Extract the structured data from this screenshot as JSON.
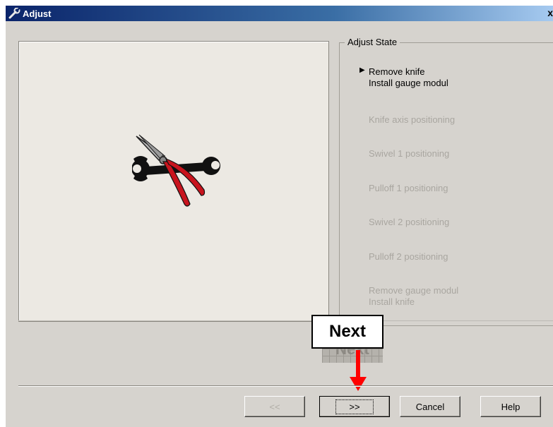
{
  "window": {
    "title": "Adjust",
    "close_label": "x"
  },
  "adjust_state": {
    "group_label": "Adjust State",
    "active_marker": "▶",
    "steps": [
      {
        "label": "Remove knife\nInstall gauge modul",
        "active": true
      },
      {
        "label": "Knife axis positioning",
        "active": false
      },
      {
        "label": "Swivel 1 positioning",
        "active": false
      },
      {
        "label": "Pulloff 1 positioning",
        "active": false
      },
      {
        "label": "Swivel 2 positioning",
        "active": false
      },
      {
        "label": "Pulloff 2 positioning",
        "active": false
      },
      {
        "label": "Remove gauge modul\nInstall knife",
        "active": false
      }
    ]
  },
  "buttons": {
    "back": "<<",
    "next": ">>",
    "cancel": "Cancel",
    "help": "Help"
  },
  "annotation": {
    "callout_text": "Next",
    "ghost_text": "Next"
  },
  "icons": {
    "title": "wrench-title-icon",
    "illustration": "pliers-wrench-icon",
    "pointer": "red-down-arrow"
  },
  "colors": {
    "arrow_red": "#ff0000",
    "pliers_red": "#c8141e",
    "title_bar": "#0a246a"
  }
}
